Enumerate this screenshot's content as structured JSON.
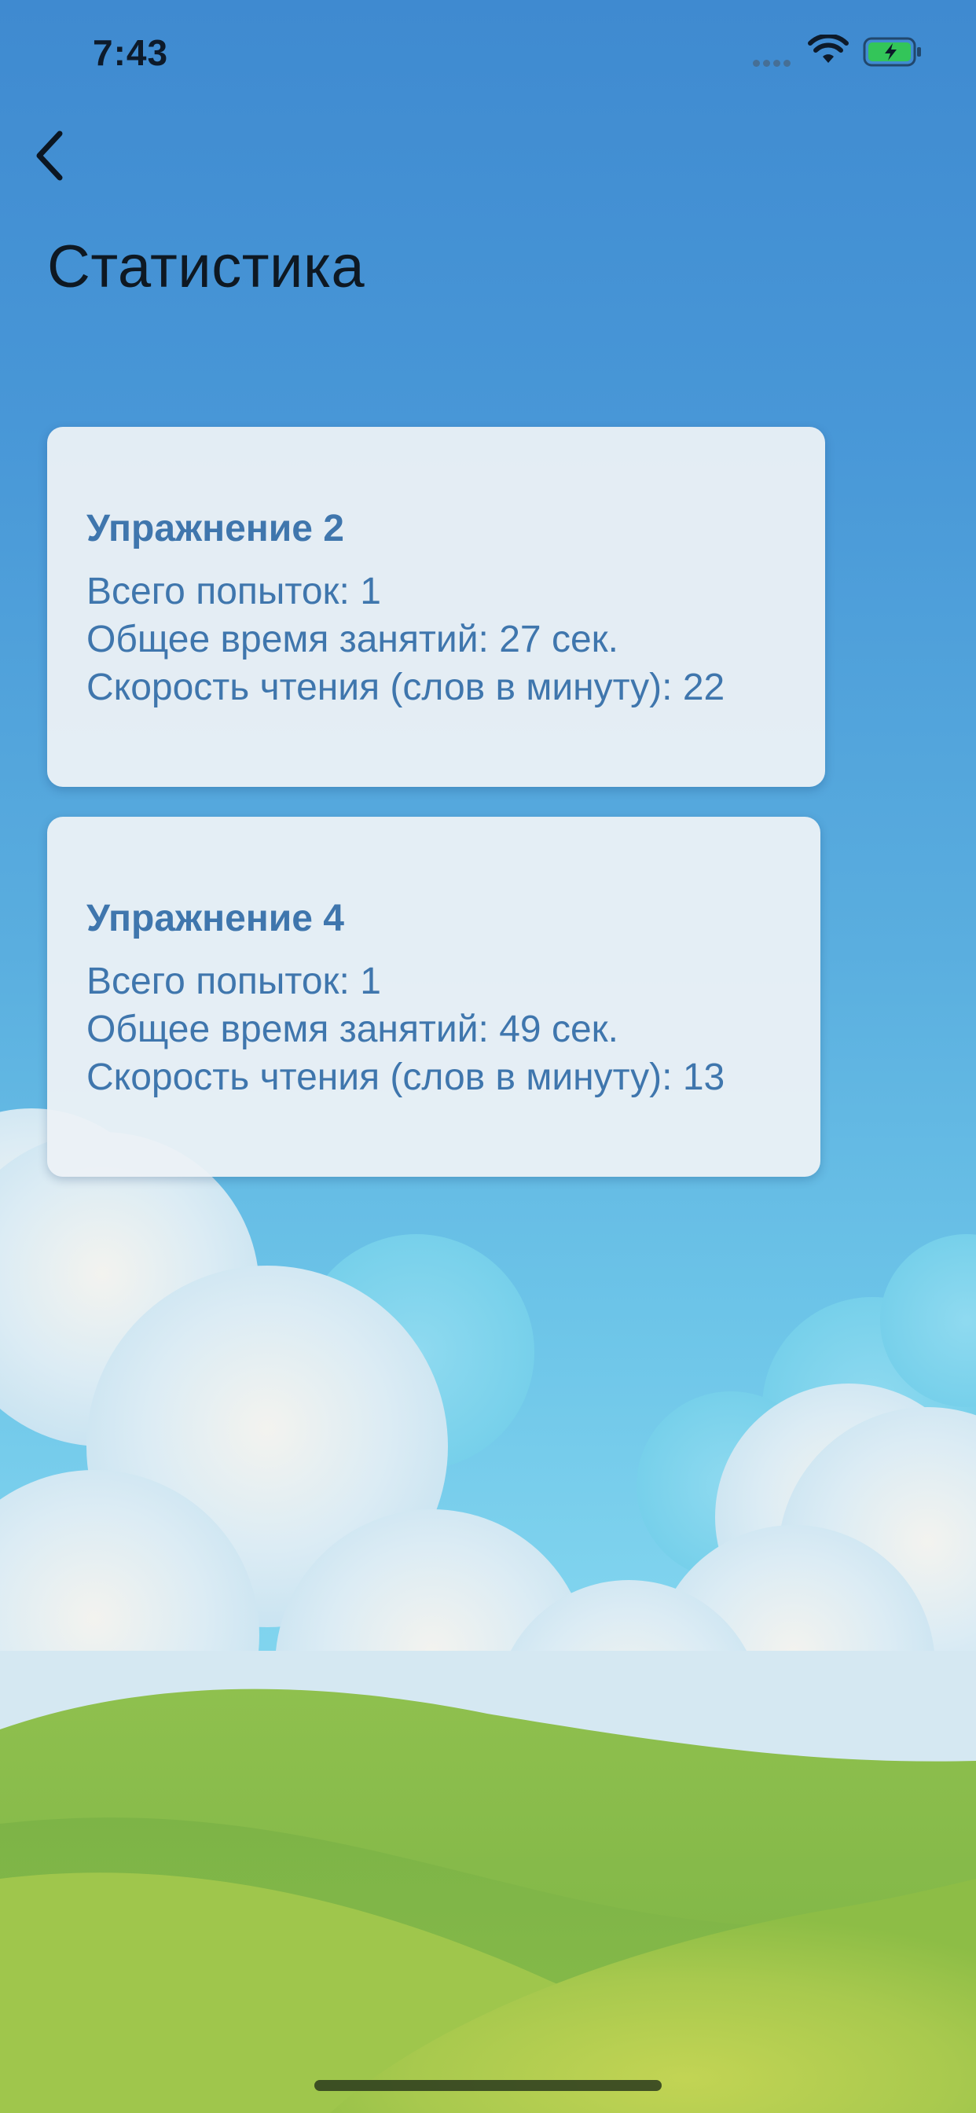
{
  "status_bar": {
    "time": "7:43"
  },
  "icons": {
    "back": "chevron-left-icon",
    "signal": "cellular-signal-icon",
    "wifi": "wifi-icon",
    "battery": "battery-charging-icon"
  },
  "colors": {
    "title_text": "#0e1822",
    "card_text": "#3f76ad",
    "card_background": "#ecf1f6",
    "battery_fill": "#33c559"
  },
  "page": {
    "title": "Статистика"
  },
  "cards": [
    {
      "title": "Упражнение 2",
      "attempts": "Всего попыток: 1",
      "total_time": "Общее время занятий: 27 сек.",
      "reading_speed": "Скорость чтения (слов в минуту): 22"
    },
    {
      "title": "Упражнение 4",
      "attempts": "Всего попыток: 1",
      "total_time": "Общее время занятий: 49 сек.",
      "reading_speed": "Скорость чтения (слов в минуту): 13"
    }
  ]
}
